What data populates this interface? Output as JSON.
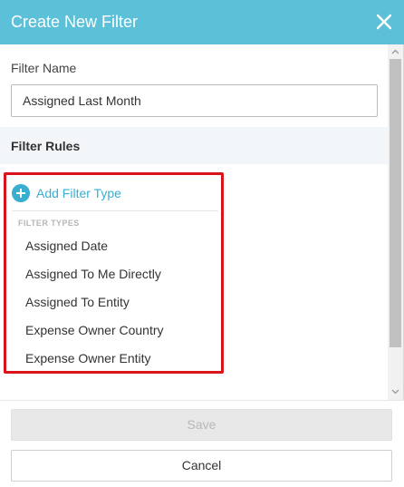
{
  "header": {
    "title": "Create New Filter",
    "close_icon": "close-icon"
  },
  "form": {
    "name_label": "Filter Name",
    "name_value": "Assigned Last Month"
  },
  "rules": {
    "title": "Filter Rules",
    "add_label": "Add Filter Type",
    "add_icon": "plus-circle-icon",
    "types_heading": "FILTER TYPES",
    "types": [
      "Assigned Date",
      "Assigned To Me Directly",
      "Assigned To Entity",
      "Expense Owner Country",
      "Expense Owner Entity"
    ]
  },
  "footer": {
    "save_label": "Save",
    "cancel_label": "Cancel"
  },
  "colors": {
    "header_bg": "#5bc0d8",
    "accent": "#3aaed0",
    "highlight": "#d9151b"
  }
}
